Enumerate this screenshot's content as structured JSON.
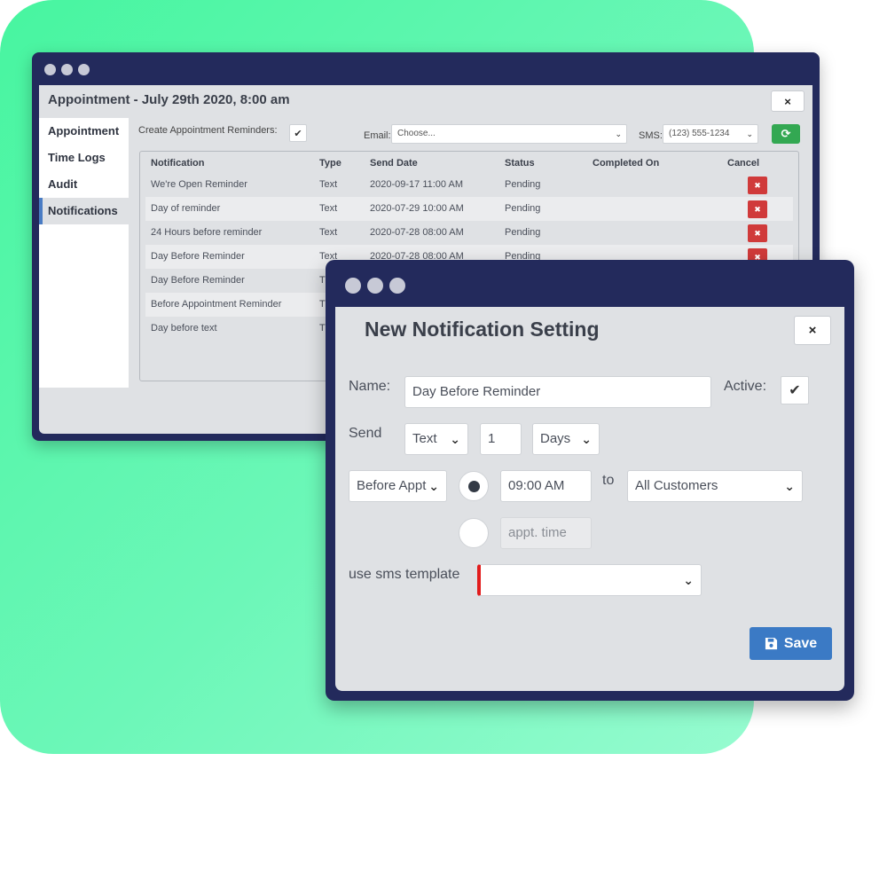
{
  "appointment_window": {
    "title": "Appointment - July 29th 2020, 8:00 am",
    "close_glyph": "×",
    "sidebar": [
      {
        "label": "Appointment"
      },
      {
        "label": "Time Logs"
      },
      {
        "label": "Audit"
      },
      {
        "label": "Notifications"
      }
    ],
    "reminders_label": "Create Appointment Reminders:",
    "check_glyph": "✔",
    "email_label": "Email:",
    "email_value": "Choose...",
    "sms_label": "SMS:",
    "sms_value": "(123) 555-1234",
    "refresh_glyph": "⟳",
    "table": {
      "headers": {
        "notification": "Notification",
        "type": "Type",
        "send_date": "Send Date",
        "status": "Status",
        "completed_on": "Completed On",
        "cancel": "Cancel"
      },
      "rows": [
        {
          "notification": "We're Open Reminder",
          "type": "Text",
          "send_date": "2020-09-17 11:00 AM",
          "status": "Pending"
        },
        {
          "notification": "Day of reminder",
          "type": "Text",
          "send_date": "2020-07-29 10:00 AM",
          "status": "Pending"
        },
        {
          "notification": "24 Hours before reminder",
          "type": "Text",
          "send_date": "2020-07-28 08:00 AM",
          "status": "Pending"
        },
        {
          "notification": "Day Before Reminder",
          "type": "Text",
          "send_date": "2020-07-28 08:00 AM",
          "status": "Pending"
        },
        {
          "notification": "Day Before Reminder",
          "type": "T",
          "send_date": "",
          "status": ""
        },
        {
          "notification": "Before Appointment Reminder",
          "type": "T",
          "send_date": "",
          "status": ""
        },
        {
          "notification": "Day before text",
          "type": "T",
          "send_date": "",
          "status": ""
        }
      ],
      "cancel_glyph": "✖"
    }
  },
  "notification_window": {
    "title": "New Notification Setting",
    "close_glyph": "×",
    "name_label": "Name:",
    "name_value": "Day Before Reminder",
    "active_label": "Active:",
    "active_glyph": "✔",
    "send_label": "Send",
    "send_type": "Text",
    "send_count": "1",
    "send_unit": "Days",
    "timing": "Before Appt",
    "time_value": "09:00 AM",
    "to_label": "to",
    "recipients": "All Customers",
    "appt_time_label": "appt. time",
    "template_label": "use sms template",
    "template_value": "",
    "save_label": "Save",
    "chevron_glyph": "⌄"
  },
  "colors": {
    "frame": "#232a5c",
    "panel": "#dfe1e4",
    "accent_blue": "#3b7ac5",
    "cancel_red": "#d03a3a",
    "refresh_green": "#33a852",
    "background_green": "#47f5a0"
  },
  "icons": [
    "close-icon",
    "check-icon",
    "chevron-down-icon",
    "refresh-icon",
    "cancel-icon",
    "save-icon"
  ]
}
